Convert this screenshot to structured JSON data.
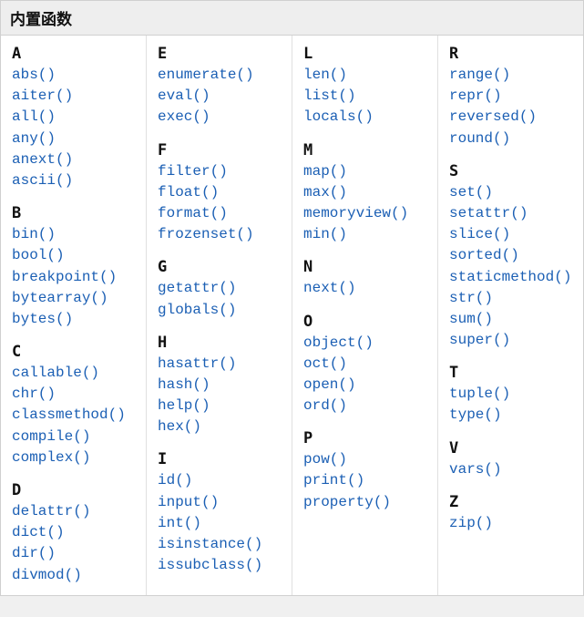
{
  "title": "内置函数",
  "columns": [
    [
      {
        "letter": "A",
        "items": [
          "abs()",
          "aiter()",
          "all()",
          "any()",
          "anext()",
          "ascii()"
        ]
      },
      {
        "letter": "B",
        "items": [
          "bin()",
          "bool()",
          "breakpoint()",
          "bytearray()",
          "bytes()"
        ]
      },
      {
        "letter": "C",
        "items": [
          "callable()",
          "chr()",
          "classmethod()",
          "compile()",
          "complex()"
        ]
      },
      {
        "letter": "D",
        "items": [
          "delattr()",
          "dict()",
          "dir()",
          "divmod()"
        ]
      }
    ],
    [
      {
        "letter": "E",
        "items": [
          "enumerate()",
          "eval()",
          "exec()"
        ]
      },
      {
        "letter": "F",
        "items": [
          "filter()",
          "float()",
          "format()",
          "frozenset()"
        ]
      },
      {
        "letter": "G",
        "items": [
          "getattr()",
          "globals()"
        ]
      },
      {
        "letter": "H",
        "items": [
          "hasattr()",
          "hash()",
          "help()",
          "hex()"
        ]
      },
      {
        "letter": "I",
        "items": [
          "id()",
          "input()",
          "int()",
          "isinstance()",
          "issubclass()"
        ]
      }
    ],
    [
      {
        "letter": "L",
        "items": [
          "len()",
          "list()",
          "locals()"
        ]
      },
      {
        "letter": "M",
        "items": [
          "map()",
          "max()",
          "memoryview()",
          "min()"
        ]
      },
      {
        "letter": "N",
        "items": [
          "next()"
        ]
      },
      {
        "letter": "O",
        "items": [
          "object()",
          "oct()",
          "open()",
          "ord()"
        ]
      },
      {
        "letter": "P",
        "items": [
          "pow()",
          "print()",
          "property()"
        ]
      }
    ],
    [
      {
        "letter": "R",
        "items": [
          "range()",
          "repr()",
          "reversed()",
          "round()"
        ]
      },
      {
        "letter": "S",
        "items": [
          "set()",
          "setattr()",
          "slice()",
          "sorted()",
          "staticmethod()",
          "str()",
          "sum()",
          "super()"
        ]
      },
      {
        "letter": "T",
        "items": [
          "tuple()",
          "type()"
        ]
      },
      {
        "letter": "V",
        "items": [
          "vars()"
        ]
      },
      {
        "letter": "Z",
        "items": [
          "zip()"
        ]
      }
    ]
  ]
}
